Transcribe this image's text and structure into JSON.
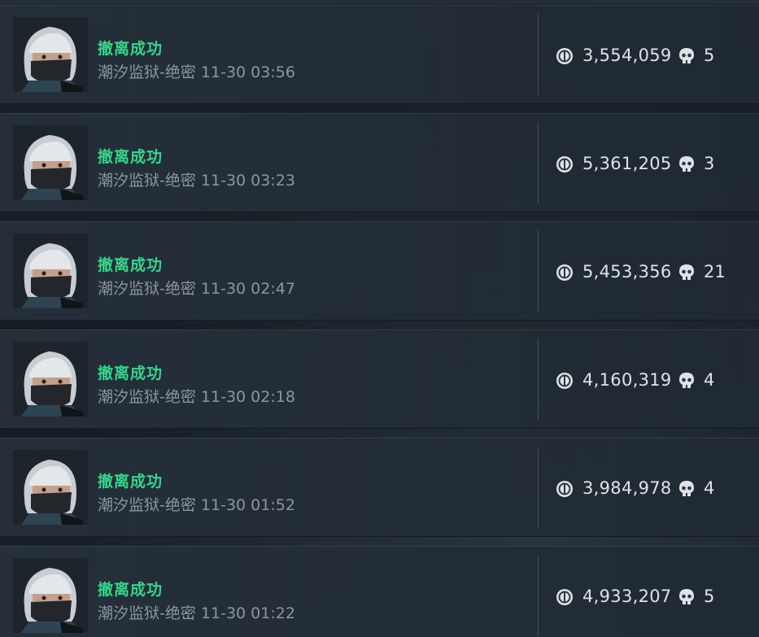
{
  "records": [
    {
      "status": "撤离成功",
      "map": "潮汐监狱-绝密",
      "time": "11-30 03:56",
      "value": "3,554,059",
      "kills": "5"
    },
    {
      "status": "撤离成功",
      "map": "潮汐监狱-绝密",
      "time": "11-30 03:23",
      "value": "5,361,205",
      "kills": "3"
    },
    {
      "status": "撤离成功",
      "map": "潮汐监狱-绝密",
      "time": "11-30 02:47",
      "value": "5,453,356",
      "kills": "21"
    },
    {
      "status": "撤离成功",
      "map": "潮汐监狱-绝密",
      "time": "11-30 02:18",
      "value": "4,160,319",
      "kills": "4"
    },
    {
      "status": "撤离成功",
      "map": "潮汐监狱-绝密",
      "time": "11-30 01:52",
      "value": "3,984,978",
      "kills": "4"
    },
    {
      "status": "撤离成功",
      "map": "潮汐监狱-绝密",
      "time": "11-30 01:22",
      "value": "4,933,207",
      "kills": "5"
    }
  ],
  "icons": {
    "avatar": "operator-avatar",
    "coin": "coin-icon",
    "kills": "skull-icon"
  },
  "colors": {
    "status": "#35d58a",
    "meta": "#8c969f",
    "value": "#dfe3e7",
    "background": "#161d24"
  }
}
